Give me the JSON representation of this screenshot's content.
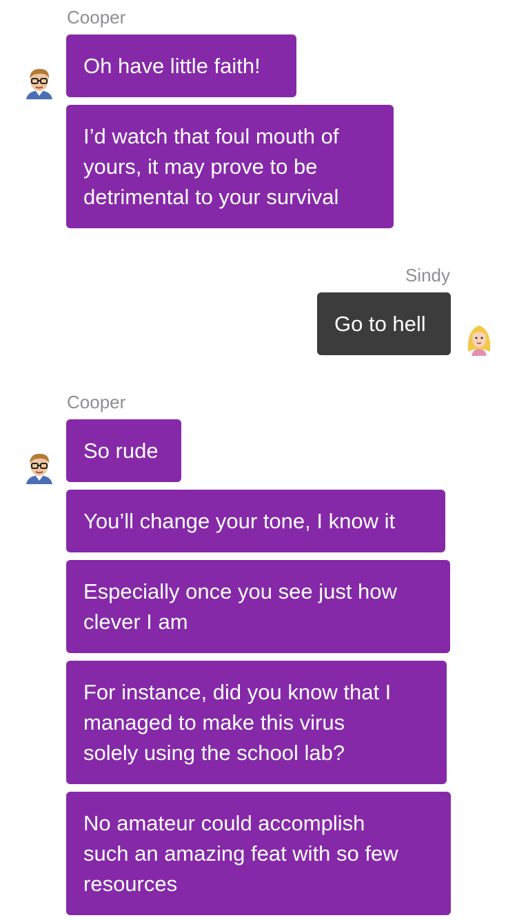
{
  "colors": {
    "incoming_bubble": "#8529a8",
    "outgoing_bubble": "#3c3c3c",
    "sender_label": "#8e8e93",
    "background": "#ffffff"
  },
  "groups": [
    {
      "sender": "Cooper",
      "side": "left",
      "avatar_icon": "cooper-avatar-icon",
      "messages": [
        "Oh have little faith!",
        "I’d watch that foul mouth of\nyours, it may prove to be\ndetrimental to your survival"
      ]
    },
    {
      "sender": "Sindy",
      "side": "right",
      "avatar_icon": "sindy-avatar-icon",
      "messages": [
        "Go to hell"
      ]
    },
    {
      "sender": "Cooper",
      "side": "left",
      "avatar_icon": "cooper-avatar-icon",
      "messages": [
        "So rude",
        "You’ll change your tone, I know it",
        "Especially once you see just how\nclever I am",
        "For instance, did you know that I\nmanaged to make this virus\nsolely using the school lab?",
        "No amateur could accomplish\nsuch an amazing feat with so few\nresources"
      ]
    }
  ]
}
